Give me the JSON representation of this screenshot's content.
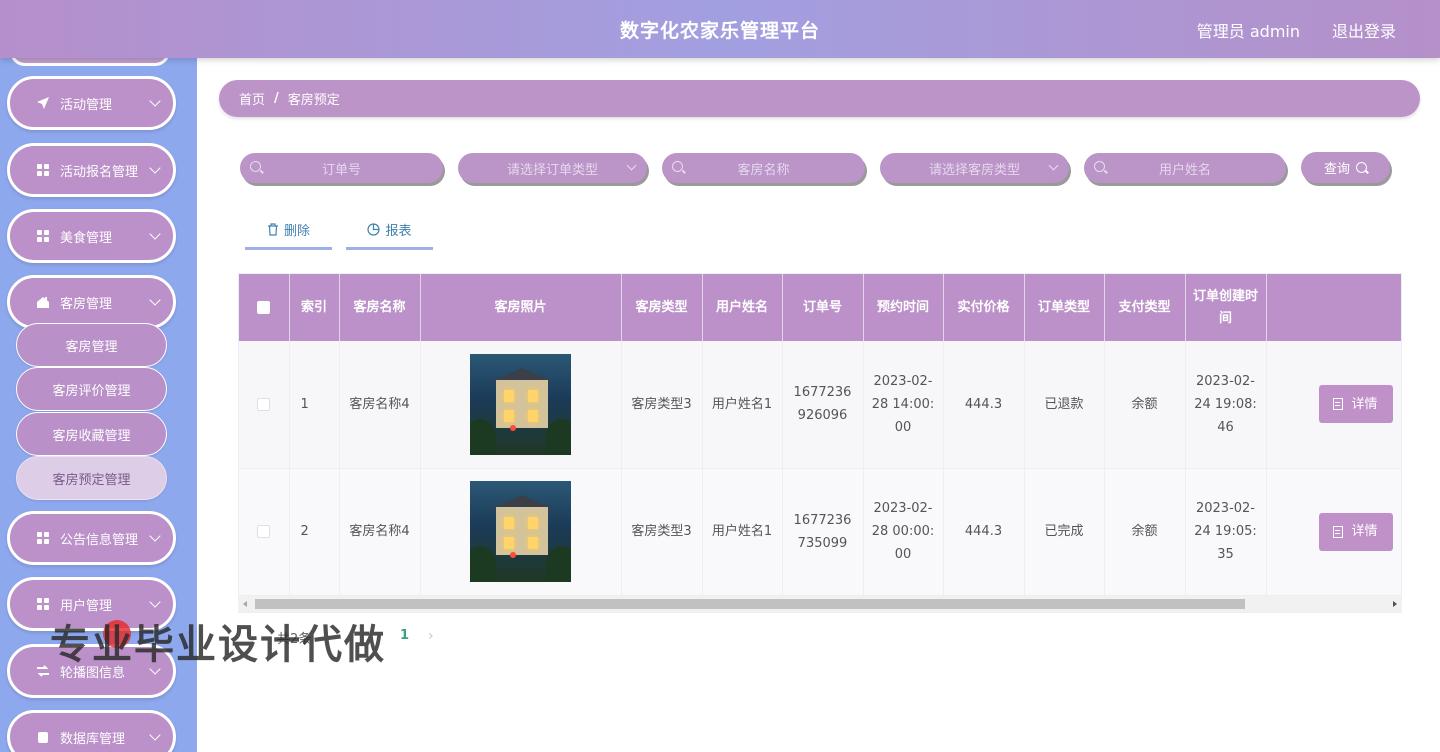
{
  "header": {
    "title": "数字化农家乐管理平台",
    "user": "管理员 admin",
    "logout": "退出登录"
  },
  "sidebar": {
    "items": [
      {
        "label": "活动管理",
        "icon": "send-icon"
      },
      {
        "label": "活动报名管理",
        "icon": "grid-icon"
      },
      {
        "label": "美食管理",
        "icon": "grid-icon"
      },
      {
        "label": "客房管理",
        "icon": "home-icon"
      },
      {
        "label": "公告信息管理",
        "icon": "grid-icon"
      },
      {
        "label": "用户管理",
        "icon": "grid-icon"
      },
      {
        "label": "轮播图信息",
        "icon": "swap-icon"
      },
      {
        "label": "数据库管理",
        "icon": "database-icon"
      }
    ],
    "submenu": [
      {
        "label": "客房管理"
      },
      {
        "label": "客房评价管理"
      },
      {
        "label": "客房收藏管理"
      },
      {
        "label": "客房预定管理",
        "active": true
      }
    ]
  },
  "breadcrumb": {
    "home": "首页",
    "separator": "/",
    "current": "客房预定"
  },
  "search": {
    "order_no": "订单号",
    "order_type": "请选择订单类型",
    "room_name": "客房名称",
    "room_type": "请选择客房类型",
    "user_name": "用户姓名",
    "query_label": "查询"
  },
  "actions": {
    "delete": "删除",
    "report": "报表"
  },
  "table": {
    "headers": [
      "索引",
      "客房名称",
      "客房照片",
      "客房类型",
      "用户姓名",
      "订单号",
      "预约时间",
      "实付价格",
      "订单类型",
      "支付类型",
      "订单创建时间"
    ],
    "rows": [
      {
        "index": "1",
        "room_name": "客房名称4",
        "room_type": "客房类型3",
        "user_name": "用户姓名1",
        "order_no": "1677236926096",
        "booking_time": "2023-02-28 14:00:00",
        "price": "444.3",
        "order_type": "已退款",
        "pay_type": "余额",
        "created": "2023-02-24 19:08:46",
        "detail": "详情"
      },
      {
        "index": "2",
        "room_name": "客房名称4",
        "room_type": "客房类型3",
        "user_name": "用户姓名1",
        "order_no": "1677236735099",
        "booking_time": "2023-02-28 00:00:00",
        "price": "444.3",
        "order_type": "已完成",
        "pay_type": "余额",
        "created": "2023-02-24 19:05:35",
        "detail": "详情"
      }
    ]
  },
  "pagination": {
    "total": "共2条",
    "page": "1",
    "next": "›"
  },
  "watermark": "专业毕业设计代做",
  "colors": {
    "accent": "#bc91c9",
    "sidebar": "#8ea8ee",
    "page_active": "#3aa37e"
  }
}
